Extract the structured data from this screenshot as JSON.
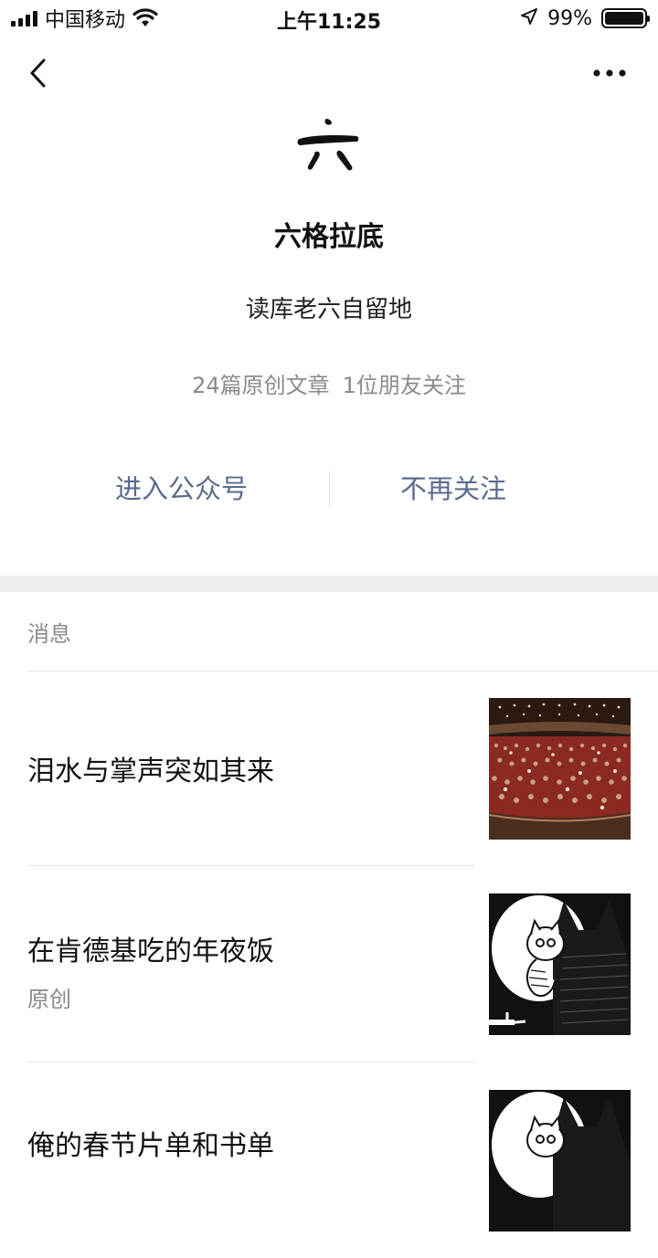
{
  "status_bar": {
    "carrier": "中国移动",
    "time": "上午11:25",
    "battery_percent": "99%",
    "battery_level": 0.99
  },
  "nav": {
    "back_icon": "chevron-left-icon",
    "more_icon": "ellipsis-icon"
  },
  "profile": {
    "name": "六格拉底",
    "description": "读库老六自留地",
    "stats_articles": "24篇原创文章",
    "stats_friends": "1位朋友关注"
  },
  "actions": {
    "enter": "进入公众号",
    "unfollow": "不再关注"
  },
  "messages": {
    "section_label": "消息",
    "items": [
      {
        "title": "泪水与掌声突如其来",
        "tag": "",
        "thumb": "theater-audience-photo"
      },
      {
        "title": "在肯德基吃的年夜饭",
        "tag": "原创",
        "thumb": "cat-illustration"
      },
      {
        "title": "俺的春节片单和书单",
        "tag": "",
        "thumb": "cat-illustration"
      }
    ]
  }
}
